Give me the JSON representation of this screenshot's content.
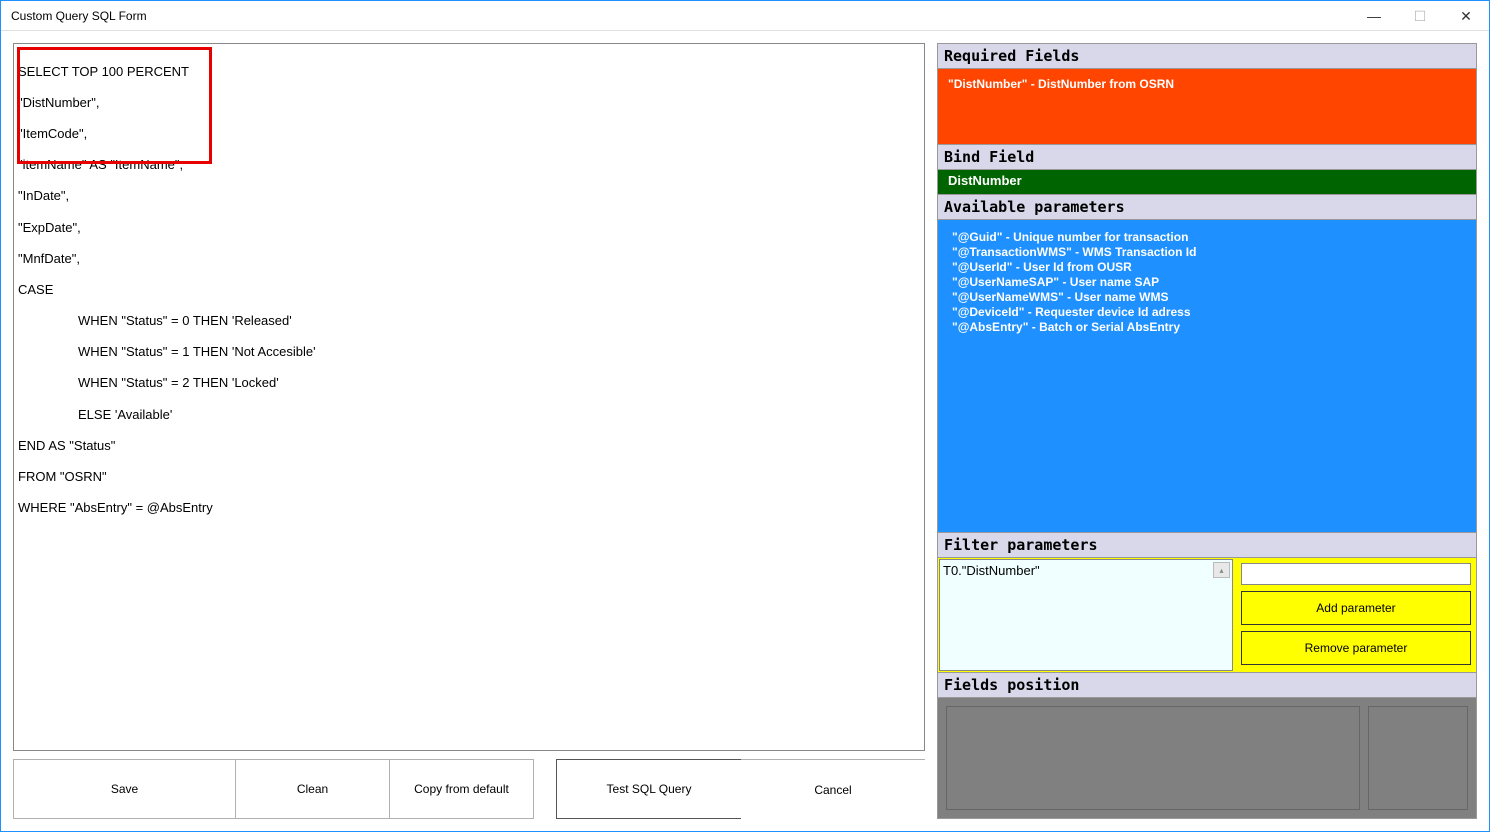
{
  "window": {
    "title": "Custom Query SQL Form"
  },
  "editor": {
    "line1": "SELECT TOP 100 PERCENT",
    "line2": "\"DistNumber\",",
    "line3": "\"ItemCode\",",
    "line4": "\"itemName\" AS \"ItemName\",",
    "line5": "\"InDate\",",
    "line6": "\"ExpDate\",",
    "line7": "\"MnfDate\",",
    "line8": "CASE",
    "line9": "WHEN \"Status\" = 0 THEN 'Released'",
    "line10": "WHEN \"Status\" = 1 THEN 'Not Accesible'",
    "line11": "WHEN \"Status\" = 2 THEN 'Locked'",
    "line12": "ELSE 'Available'",
    "line13": "END AS \"Status\"",
    "line14": "FROM \"OSRN\"",
    "line15": "WHERE \"AbsEntry\" = @AbsEntry"
  },
  "buttons": {
    "save": "Save",
    "clean": "Clean",
    "copy": "Copy from default",
    "test": "Test SQL Query",
    "cancel": "Cancel"
  },
  "sections": {
    "required": "Required Fields",
    "bind": "Bind Field",
    "available": "Available parameters",
    "filter": "Filter parameters",
    "position": "Fields position"
  },
  "required_field": "\"DistNumber\" - DistNumber from OSRN",
  "bind_field": "DistNumber",
  "params": {
    "p1": "\"@Guid\" - Unique number for transaction",
    "p2": "\"@TransactionWMS\" - WMS Transaction Id",
    "p3": "\"@UserId\" - User Id from OUSR",
    "p4": "\"@UserNameSAP\" - User name SAP",
    "p5": "\"@UserNameWMS\" - User name WMS",
    "p6": "\"@DeviceId\" - Requester device Id adress",
    "p7": "\"@AbsEntry\" - Batch or Serial AbsEntry"
  },
  "filter": {
    "text": "T0.\"DistNumber\"",
    "add": "Add parameter",
    "remove": "Remove parameter"
  }
}
